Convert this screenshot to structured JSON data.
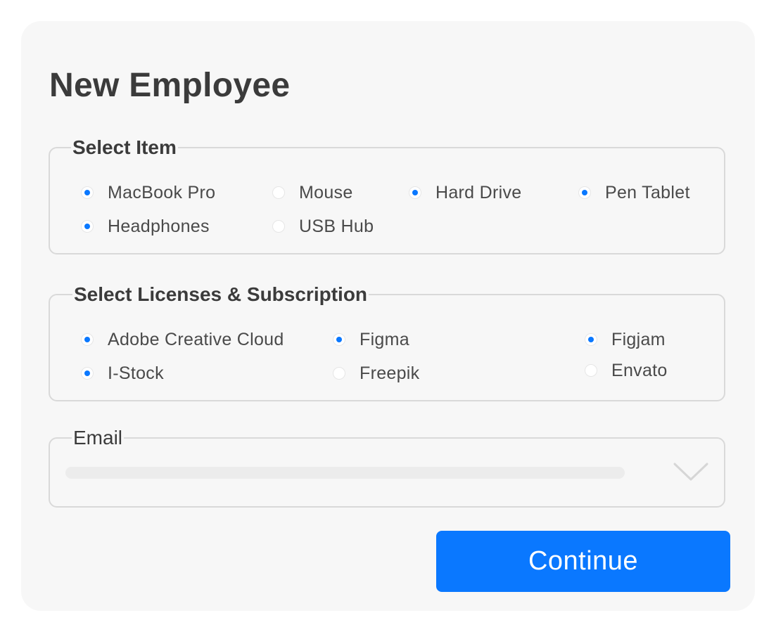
{
  "form": {
    "title": "New Employee",
    "items": {
      "legend": "Select Item",
      "options": [
        {
          "label": "MacBook Pro",
          "checked": true
        },
        {
          "label": "Mouse",
          "checked": false
        },
        {
          "label": "Hard Drive",
          "checked": true
        },
        {
          "label": "Pen Tablet",
          "checked": true
        },
        {
          "label": "Headphones",
          "checked": true
        },
        {
          "label": "USB Hub",
          "checked": false
        }
      ]
    },
    "licenses": {
      "legend": "Select Licenses & Subscription",
      "options": [
        {
          "label": "Adobe Creative Cloud",
          "checked": true
        },
        {
          "label": "Figma",
          "checked": true
        },
        {
          "label": "Figjam",
          "checked": true
        },
        {
          "label": "I-Stock",
          "checked": true
        },
        {
          "label": "Freepik",
          "checked": false
        },
        {
          "label": "Envato",
          "checked": false
        }
      ]
    },
    "email": {
      "label": "Email",
      "value": "",
      "dropdown_icon": "chevron-down-icon"
    },
    "continue_label": "Continue"
  },
  "colors": {
    "accent": "#0a78ff",
    "card_bg": "#f7f7f7",
    "border": "#d9d9d9",
    "text": "#3b3b3b"
  }
}
